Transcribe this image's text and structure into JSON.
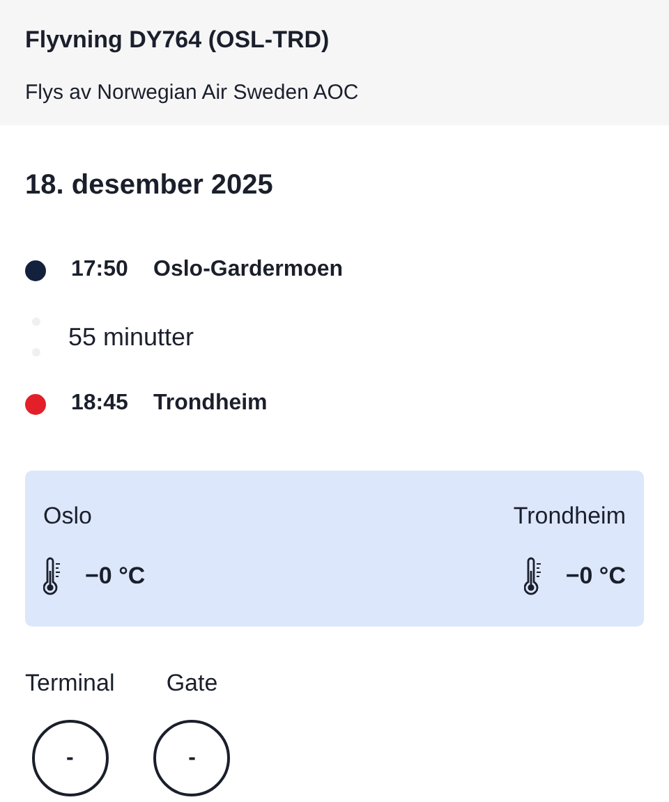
{
  "header": {
    "title": "Flyvning DY764 (OSL-TRD)",
    "subtitle": "Flys av Norwegian Air Sweden AOC"
  },
  "date": "18. desember 2025",
  "timeline": [
    {
      "kind": "stop",
      "time": "17:50",
      "place": "Oslo-Gardermoen",
      "color": "#14213d"
    },
    {
      "kind": "duration",
      "text": "55 minutter"
    },
    {
      "kind": "stop",
      "time": "18:45",
      "place": "Trondheim",
      "color": "#e3202a"
    }
  ],
  "weather": [
    {
      "city": "Oslo",
      "temperature": "−0 °C"
    },
    {
      "city": "Trondheim",
      "temperature": "−0 °C"
    }
  ],
  "info": [
    {
      "label": "Terminal",
      "value": "-"
    },
    {
      "label": "Gate",
      "value": "-"
    }
  ]
}
